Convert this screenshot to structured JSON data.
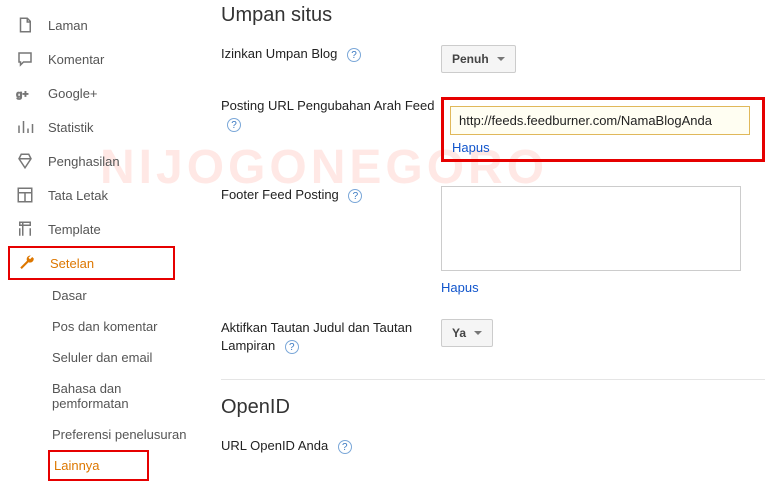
{
  "watermark": "NIJOGONEGORO",
  "sidebar": {
    "items": [
      {
        "label": "Laman"
      },
      {
        "label": "Komentar"
      },
      {
        "label": "Google+"
      },
      {
        "label": "Statistik"
      },
      {
        "label": "Penghasilan"
      },
      {
        "label": "Tata Letak"
      },
      {
        "label": "Template"
      },
      {
        "label": "Setelan"
      }
    ],
    "subitems": [
      {
        "label": "Dasar"
      },
      {
        "label": "Pos dan komentar"
      },
      {
        "label": "Seluler dan email"
      },
      {
        "label": "Bahasa dan pemformatan"
      },
      {
        "label": "Preferensi penelusuran"
      },
      {
        "label": "Lainnya"
      }
    ]
  },
  "section1": {
    "title": "Umpan situs",
    "allow_label": "Izinkan Umpan Blog",
    "allow_value": "Penuh",
    "redirect_label": "Posting URL Pengubahan Arah Feed",
    "redirect_value": "http://feeds.feedburner.com/NamaBlogAnda",
    "footer_label": "Footer Feed Posting",
    "delete_link": "Hapus",
    "enclosure_label": "Aktifkan Tautan Judul dan Tautan Lampiran",
    "enclosure_value": "Ya"
  },
  "section2": {
    "title": "OpenID",
    "url_label": "URL OpenID Anda"
  },
  "help_glyph": "?"
}
